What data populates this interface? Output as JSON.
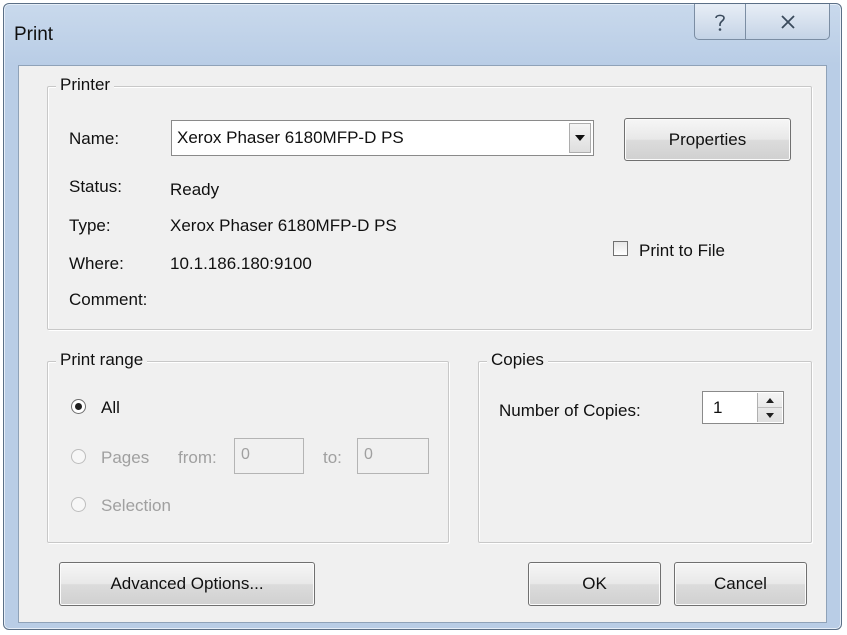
{
  "window": {
    "title": "Print"
  },
  "printer": {
    "legend": "Printer",
    "name_label": "Name:",
    "name_value": "Xerox Phaser 6180MFP-D PS",
    "properties_label": "Properties",
    "status_label": "Status:",
    "status_value": "Ready",
    "type_label": "Type:",
    "type_value": "Xerox Phaser 6180MFP-D PS",
    "where_label": "Where:",
    "where_value": "10.1.186.180:9100",
    "comment_label": "Comment:",
    "print_to_file_label": "Print to File",
    "print_to_file_checked": false
  },
  "print_range": {
    "legend": "Print range",
    "all_label": "All",
    "pages_label": "Pages",
    "from_label": "from:",
    "from_value": "0",
    "to_label": "to:",
    "to_value": "0",
    "selection_label": "Selection",
    "selected": "All"
  },
  "copies": {
    "legend": "Copies",
    "number_label": "Number of Copies:",
    "number_value": "1"
  },
  "footer": {
    "advanced_label": "Advanced Options...",
    "ok_label": "OK",
    "cancel_label": "Cancel"
  },
  "icons": {
    "help": "question-mark-icon",
    "close": "close-x-icon",
    "dropdown": "triangle-down-icon"
  },
  "colors": {
    "frame": "#b9cde6",
    "client": "#f0f0f0",
    "disabled_text": "#a0a0a0"
  }
}
